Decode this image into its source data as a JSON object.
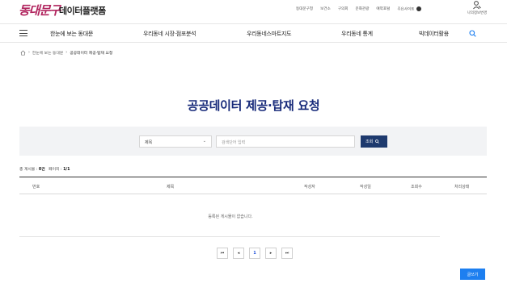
{
  "header": {
    "logo_text": "동대문구",
    "site_name": "데이터플랫폼",
    "util_links": [
      "동대문구청",
      "보건소",
      "구의회",
      "문화관광",
      "예약포털",
      "주요사이트"
    ],
    "user_label": "나의정보변경"
  },
  "nav": {
    "items": [
      "한눈에 보는 동대문",
      "우리동네 시장·점포분석",
      "우리동네스마트지도",
      "우리동네 통계",
      "빅데이터활용"
    ]
  },
  "breadcrumb": {
    "items": [
      "한눈에 보는 동대문",
      "공공데이터 제공·탑재 요청"
    ]
  },
  "page": {
    "title": "공공데이터 제공·탑재 요청"
  },
  "search": {
    "select_value": "제목",
    "keyword_placeholder": "검색단어 입력",
    "button_label": "조회"
  },
  "summary": {
    "total_label": "총 게시물 :",
    "total_value": "0건",
    "page_label": "페이지 :",
    "page_value": "1/1"
  },
  "table": {
    "columns": [
      "번호",
      "제목",
      "작성자",
      "작성일",
      "조회수",
      "처리상태"
    ],
    "empty_message": "등록된 게시물이 없습니다."
  },
  "pagination": {
    "current": "1"
  },
  "actions": {
    "write_label": "글쓰기"
  },
  "colors": {
    "brand": "#b1245e",
    "title": "#172a7a",
    "search_button": "#1e3a6e",
    "write_button": "#1d7ff0"
  }
}
